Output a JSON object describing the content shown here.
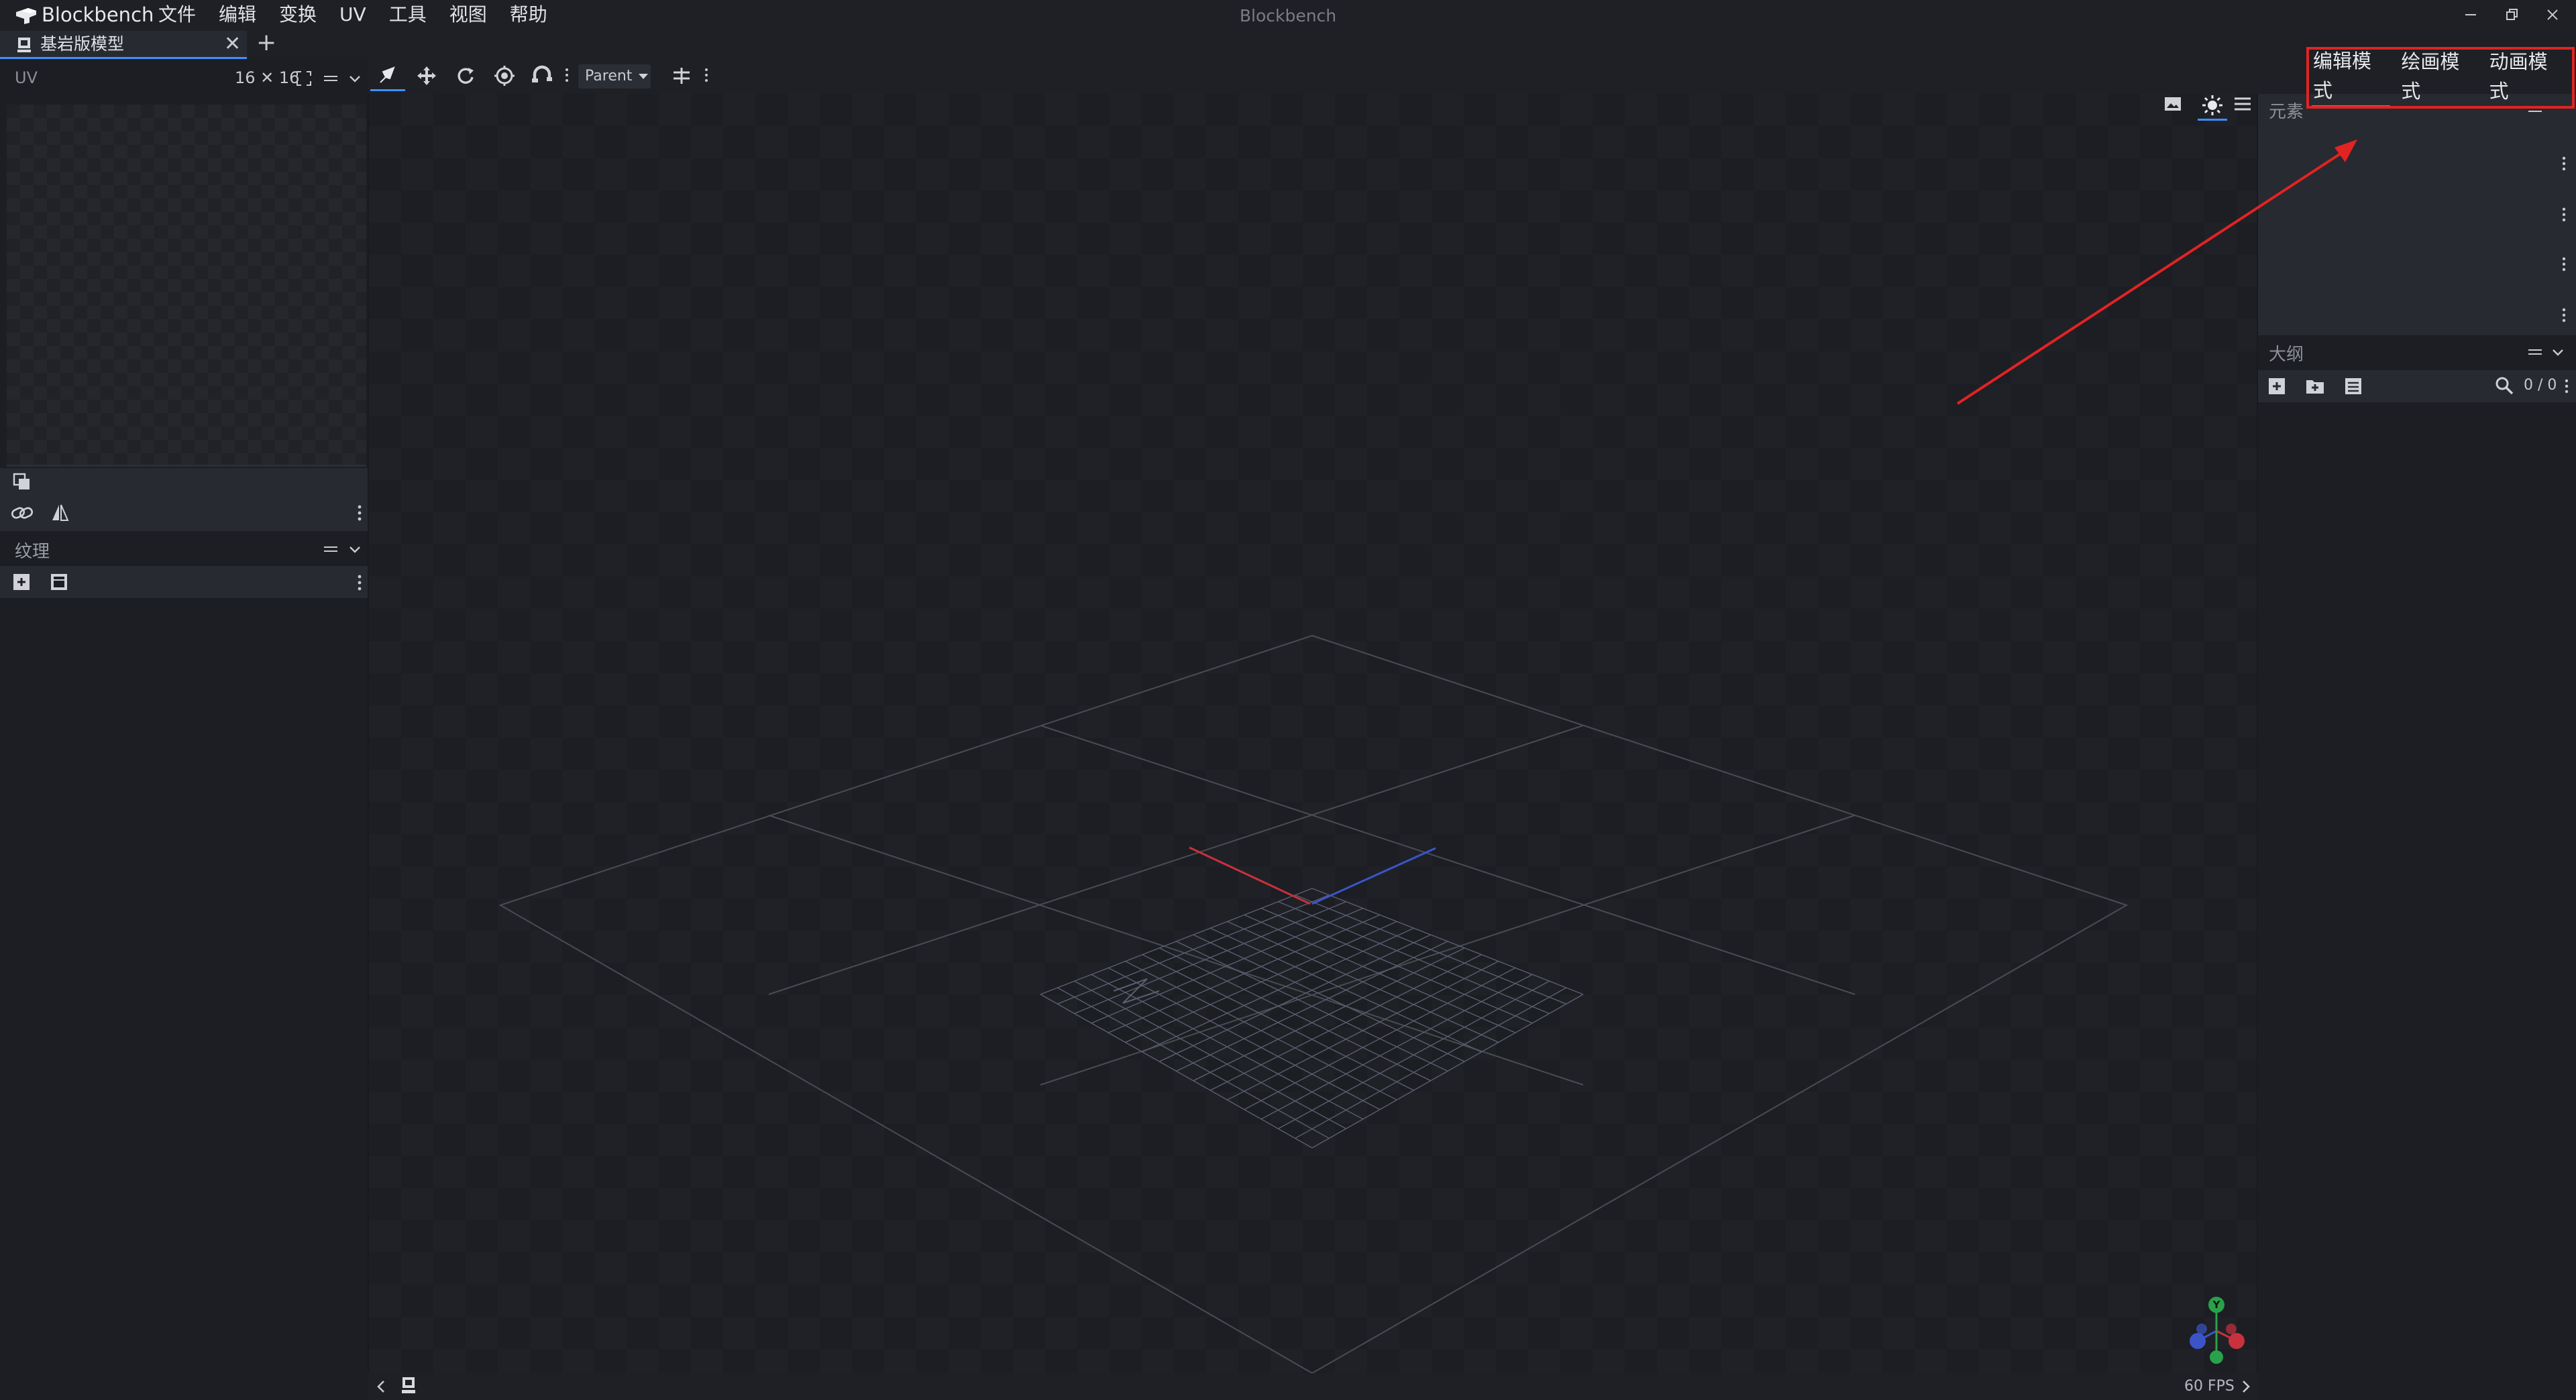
{
  "app": {
    "name": "Blockbench",
    "window_title": "Blockbench"
  },
  "menu": [
    "文件",
    "编辑",
    "变换",
    "UV",
    "工具",
    "视图",
    "帮助"
  ],
  "tab": {
    "label": "基岩版模型",
    "close": "✕",
    "add": "+"
  },
  "uv_panel": {
    "title": "UV",
    "size": "16 ✕ 16"
  },
  "textures_panel": {
    "title": "纹理"
  },
  "viewport_toolbar": {
    "parent_option": "Parent"
  },
  "viewport": {
    "fps": "60 FPS"
  },
  "modes": {
    "edit": "编辑模式",
    "paint": "绘画模式",
    "animate": "动画模式"
  },
  "elements_panel": {
    "title": "元素"
  },
  "outline_panel": {
    "title": "大纲",
    "count": "0 / 0"
  },
  "gizmo": {
    "y_label": "Y"
  },
  "colors": {
    "accent": "#3e90ff",
    "annotation": "#e12323",
    "axis_x": "#c8313d",
    "axis_z": "#3b55c9",
    "axis_y": "#2aa14b"
  }
}
